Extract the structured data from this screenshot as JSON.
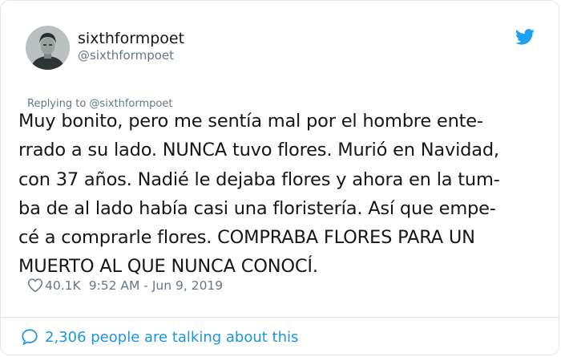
{
  "user": {
    "display_name": "sixthformpoet",
    "handle": "@sixthformpoet"
  },
  "reply_to": "Replying to @sixthformpoet",
  "tweet_text": "Muy bonito, pero me sentía mal por el hombre ente-\nrrado a su lado. NUNCA tuvo flores. Murió en Navidad,\ncon 37 años. Nadié le dejaba flores y ahora en la tum-\nba de al lado había casi una floristería. Así que empe-\ncé a comprarle flores. COMPRABA FLORES PARA UN\nMUERTO AL QUE NUNCA CONOCÍ.",
  "likes": "40.1K",
  "timestamp": "9:52 AM - Jun 9, 2019",
  "footer": {
    "talking": "2,306 people are talking about this"
  },
  "icons": {
    "brand": "twitter-bird-icon",
    "like": "heart-icon",
    "conversation": "speech-bubble-icon"
  },
  "colors": {
    "brand": "#1da1f2",
    "link": "#1b95e0",
    "muted": "#657786",
    "text": "#14171a"
  }
}
